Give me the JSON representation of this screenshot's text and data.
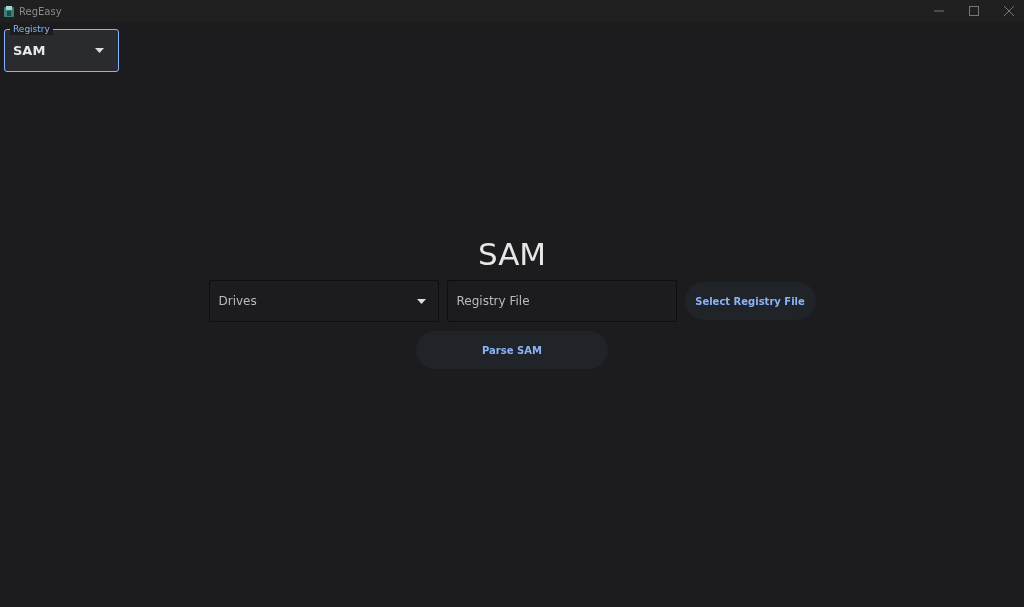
{
  "window": {
    "title": "RegEasy"
  },
  "registry_select": {
    "label": "Registry",
    "value": "SAM"
  },
  "heading": "SAM",
  "drives_select": {
    "placeholder": "Drives"
  },
  "registry_file_field": {
    "placeholder": "Registry File"
  },
  "buttons": [
    {
      "label": "Select Registry File"
    },
    {
      "label": "Parse SAM"
    }
  ]
}
